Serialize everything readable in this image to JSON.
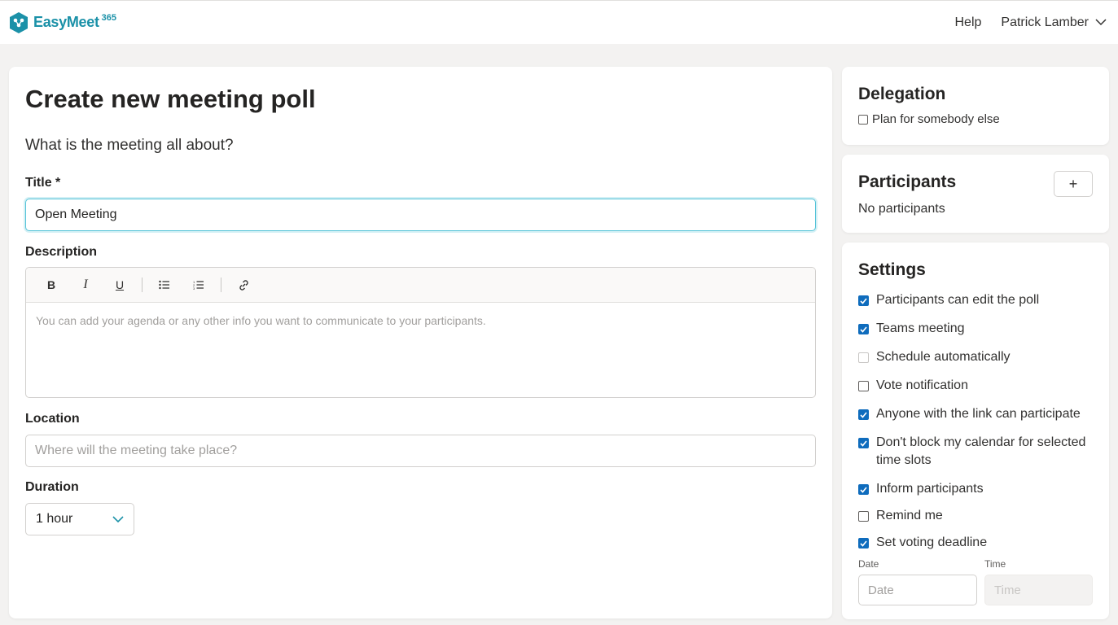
{
  "app": {
    "brand_name": "EasyMeet",
    "brand_sup": "365",
    "brand_color": "#1b91a8"
  },
  "nav": {
    "help": "Help",
    "user_name": "Patrick Lamber"
  },
  "main": {
    "title": "Create new meeting poll",
    "subtitle": "What is the meeting all about?",
    "title_label": "Title *",
    "title_value": "Open Meeting",
    "description_label": "Description",
    "description_placeholder": "You can add your agenda or any other info you want to communicate to your participants.",
    "toolbar": {
      "bold": "B",
      "italic": "I",
      "underline": "U"
    },
    "location_label": "Location",
    "location_placeholder": "Where will the meeting take place?",
    "duration_label": "Duration",
    "duration_value": "1 hour"
  },
  "delegation": {
    "title": "Delegation",
    "plan_label": "Plan for somebody else",
    "plan_checked": false
  },
  "participants": {
    "title": "Participants",
    "add_label": "+",
    "empty_text": "No participants"
  },
  "settings": {
    "title": "Settings",
    "items": [
      {
        "label": "Participants can edit the poll",
        "checked": true
      },
      {
        "label": "Teams meeting",
        "checked": true
      },
      {
        "label": "Schedule automatically",
        "checked": false,
        "disabled": true
      },
      {
        "label": "Vote notification",
        "checked": false
      },
      {
        "label": "Anyone with the link can participate",
        "checked": true
      },
      {
        "label": "Don't block my calendar for selected time slots",
        "checked": true
      },
      {
        "label": "Inform participants",
        "checked": true
      },
      {
        "label": "Remind me",
        "checked": false
      },
      {
        "label": "Set voting deadline",
        "checked": true
      }
    ],
    "date_label": "Date",
    "time_label": "Time",
    "date_placeholder": "Date",
    "time_placeholder": "Time"
  },
  "colors": {
    "accent": "#1b91a8",
    "checkbox": "#0f6cbd",
    "focus": "#55c3d8"
  }
}
